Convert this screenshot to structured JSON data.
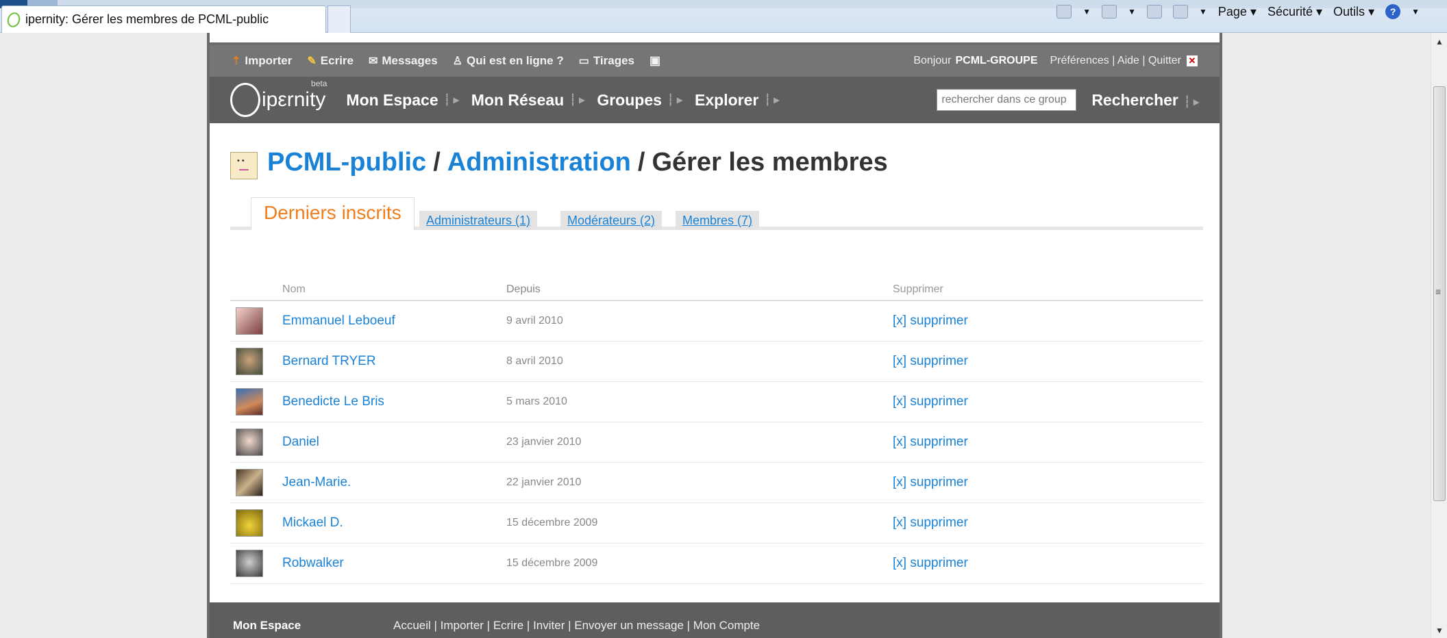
{
  "browser": {
    "tab_title": "ipernity: Gérer les membres de PCML-public",
    "cmd_page": "Page",
    "cmd_security": "Sécurité",
    "cmd_tools": "Outils"
  },
  "userbar": {
    "items": [
      {
        "label": "Importer",
        "icon": "upload-icon"
      },
      {
        "label": "Ecrire",
        "icon": "pencil-icon"
      },
      {
        "label": "Messages",
        "icon": "envelope-icon"
      },
      {
        "label": "Qui est en ligne ?",
        "icon": "person-icon"
      },
      {
        "label": "Tirages",
        "icon": "print-icon"
      }
    ],
    "greeting": "Bonjour",
    "username": "PCML-GROUPE",
    "links": "Préférences | Aide | Quitter"
  },
  "nav": {
    "logo": "ipεrnity",
    "beta": "beta",
    "items": [
      "Mon Espace",
      "Mon Réseau",
      "Groupes",
      "Explorer"
    ],
    "search_placeholder": "rechercher dans ce group",
    "search_button": "Rechercher"
  },
  "title": {
    "group": "PCML-public",
    "section": "Administration",
    "page": "Gérer les membres",
    "sep": "/"
  },
  "tabs": {
    "active": "Derniers inscrits",
    "admins": "Administrateurs (1)",
    "moderators": "Modérateurs (2)",
    "members": "Membres (7)"
  },
  "table": {
    "headers": {
      "name": "Nom",
      "since": "Depuis",
      "delete": "Supprimer"
    },
    "delete_label": "[x] supprimer",
    "rows": [
      {
        "name": "Emmanuel Leboeuf",
        "since": "9 avril 2010"
      },
      {
        "name": "Bernard TRYER",
        "since": "8 avril 2010"
      },
      {
        "name": "Benedicte Le Bris",
        "since": "5 mars 2010"
      },
      {
        "name": "Daniel",
        "since": "23 janvier 2010"
      },
      {
        "name": "Jean-Marie.",
        "since": "22 janvier 2010"
      },
      {
        "name": "Mickael D.",
        "since": "15 décembre 2009"
      },
      {
        "name": "Robwalker",
        "since": "15 décembre 2009"
      }
    ]
  },
  "footer": {
    "title": "Mon Espace",
    "links": "Accueil | Importer | Ecrire | Inviter | Envoyer un message | Mon Compte"
  },
  "colors": {
    "link": "#1a82d6",
    "active_tab": "#f07d1a",
    "bar": "#5e5e5e"
  }
}
